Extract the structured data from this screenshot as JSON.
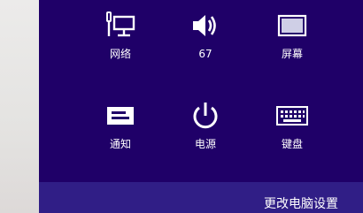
{
  "quick_settings": {
    "network": {
      "label": "网络",
      "icon": "network-icon"
    },
    "volume": {
      "label": "67",
      "icon": "volume-icon"
    },
    "screen": {
      "label": "屏幕",
      "icon": "screen-icon"
    },
    "notifications": {
      "label": "通知",
      "icon": "notifications-icon"
    },
    "power": {
      "label": "电源",
      "icon": "power-icon"
    },
    "keyboard": {
      "label": "键盘",
      "icon": "keyboard-icon"
    }
  },
  "footer": {
    "change_pc_settings": "更改电脑设置"
  },
  "colors": {
    "panel": "#1f0068",
    "footer": "#301e86",
    "text": "#ffffff"
  }
}
